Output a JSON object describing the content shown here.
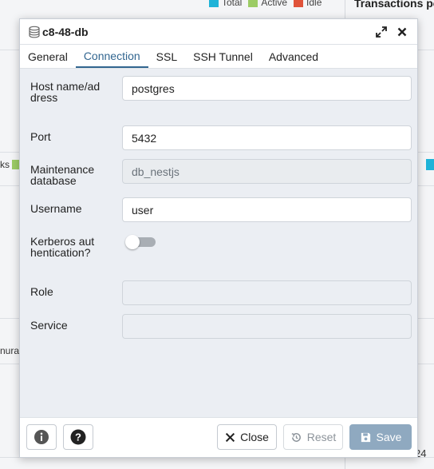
{
  "background": {
    "legend": [
      {
        "label": "Total",
        "color": "#1fb3d8"
      },
      {
        "label": "Active",
        "color": "#9ccc65"
      },
      {
        "label": "Idle",
        "color": "#e0533a"
      }
    ],
    "right_panel_title": "Transactions pe",
    "left_fragment": "ks",
    "left_fragment_color": "#9ccc65",
    "left_fragment2": "nura",
    "bottom_right_fragment": "24"
  },
  "dialog": {
    "title": "c8-48-db",
    "tabs": [
      {
        "label": "General",
        "active": false
      },
      {
        "label": "Connection",
        "active": true
      },
      {
        "label": "SSL",
        "active": false
      },
      {
        "label": "SSH Tunnel",
        "active": false
      },
      {
        "label": "Advanced",
        "active": false
      }
    ],
    "fields": {
      "host": {
        "label": "Host name/address",
        "value": "postgres"
      },
      "port": {
        "label": "Port",
        "value": "5432"
      },
      "maintenance_db": {
        "label": "Maintenance database",
        "value": "db_nestjs"
      },
      "username": {
        "label": "Username",
        "value": "user"
      },
      "kerberos": {
        "label": "Kerberos authentication?",
        "value": false
      },
      "role": {
        "label": "Role",
        "value": ""
      },
      "service": {
        "label": "Service",
        "value": ""
      }
    },
    "footer": {
      "close_label": "Close",
      "reset_label": "Reset",
      "save_label": "Save"
    }
  },
  "colors": {
    "accent": "#326690",
    "save_button": "#8fa9c0"
  }
}
